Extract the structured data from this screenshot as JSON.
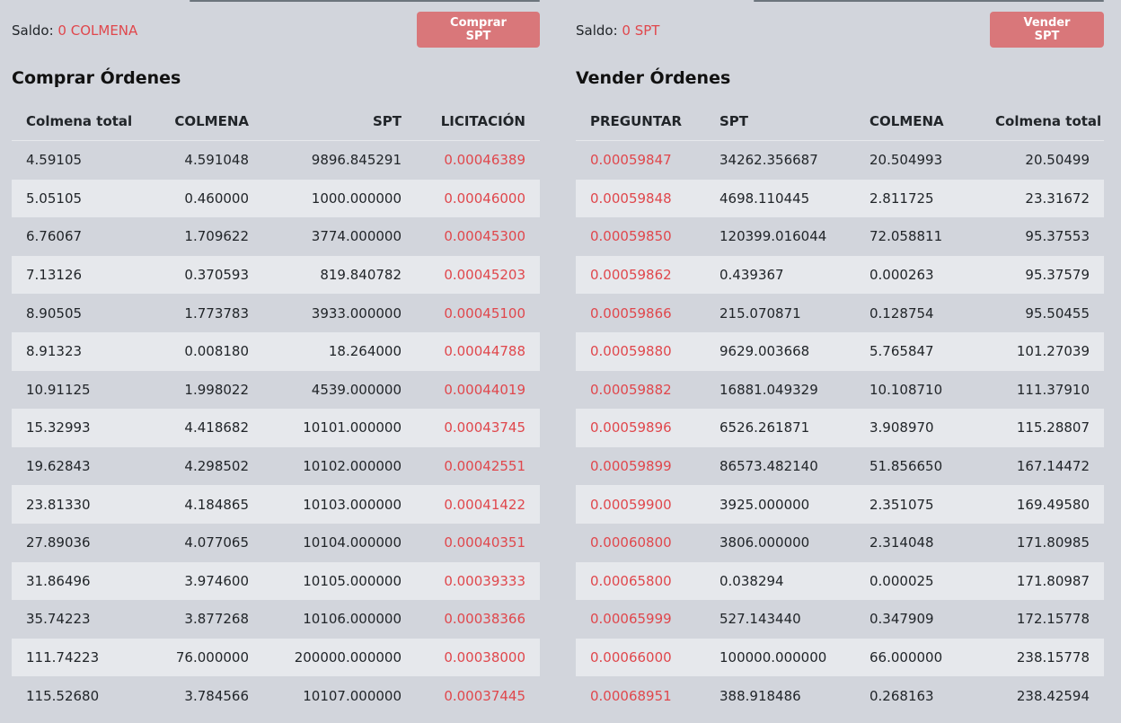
{
  "buy": {
    "saldo_label": "Saldo:",
    "saldo_value": "0 COLMENA",
    "button_label": "Comprar SPT",
    "title": "Comprar Órdenes",
    "headers": [
      "Colmena total",
      "COLMENA",
      "SPT",
      "LICITACIÓN"
    ],
    "rows": [
      [
        "4.59105",
        "4.591048",
        "9896.845291",
        "0.00046389"
      ],
      [
        "5.05105",
        "0.460000",
        "1000.000000",
        "0.00046000"
      ],
      [
        "6.76067",
        "1.709622",
        "3774.000000",
        "0.00045300"
      ],
      [
        "7.13126",
        "0.370593",
        "819.840782",
        "0.00045203"
      ],
      [
        "8.90505",
        "1.773783",
        "3933.000000",
        "0.00045100"
      ],
      [
        "8.91323",
        "0.008180",
        "18.264000",
        "0.00044788"
      ],
      [
        "10.91125",
        "1.998022",
        "4539.000000",
        "0.00044019"
      ],
      [
        "15.32993",
        "4.418682",
        "10101.000000",
        "0.00043745"
      ],
      [
        "19.62843",
        "4.298502",
        "10102.000000",
        "0.00042551"
      ],
      [
        "23.81330",
        "4.184865",
        "10103.000000",
        "0.00041422"
      ],
      [
        "27.89036",
        "4.077065",
        "10104.000000",
        "0.00040351"
      ],
      [
        "31.86496",
        "3.974600",
        "10105.000000",
        "0.00039333"
      ],
      [
        "35.74223",
        "3.877268",
        "10106.000000",
        "0.00038366"
      ],
      [
        "111.74223",
        "76.000000",
        "200000.000000",
        "0.00038000"
      ],
      [
        "115.52680",
        "3.784566",
        "10107.000000",
        "0.00037445"
      ]
    ]
  },
  "sell": {
    "saldo_label": "Saldo:",
    "saldo_value": "0 SPT",
    "button_label": "Vender SPT",
    "title": "Vender Órdenes",
    "headers": [
      "PREGUNTAR",
      "SPT",
      "COLMENA",
      "Colmena total"
    ],
    "rows": [
      [
        "0.00059847",
        "34262.356687",
        "20.504993",
        "20.50499"
      ],
      [
        "0.00059848",
        "4698.110445",
        "2.811725",
        "23.31672"
      ],
      [
        "0.00059850",
        "120399.016044",
        "72.058811",
        "95.37553"
      ],
      [
        "0.00059862",
        "0.439367",
        "0.000263",
        "95.37579"
      ],
      [
        "0.00059866",
        "215.070871",
        "0.128754",
        "95.50455"
      ],
      [
        "0.00059880",
        "9629.003668",
        "5.765847",
        "101.27039"
      ],
      [
        "0.00059882",
        "16881.049329",
        "10.108710",
        "111.37910"
      ],
      [
        "0.00059896",
        "6526.261871",
        "3.908970",
        "115.28807"
      ],
      [
        "0.00059899",
        "86573.482140",
        "51.856650",
        "167.14472"
      ],
      [
        "0.00059900",
        "3925.000000",
        "2.351075",
        "169.49580"
      ],
      [
        "0.00060800",
        "3806.000000",
        "2.314048",
        "171.80985"
      ],
      [
        "0.00065800",
        "0.038294",
        "0.000025",
        "171.80987"
      ],
      [
        "0.00065999",
        "527.143440",
        "0.347909",
        "172.15778"
      ],
      [
        "0.00066000",
        "100000.000000",
        "66.000000",
        "238.15778"
      ],
      [
        "0.00068951",
        "388.918486",
        "0.268163",
        "238.42594"
      ]
    ]
  },
  "colors": {
    "accent_red": "#e0474c",
    "button_bg": "#d9777a",
    "page_bg": "#d2d5dc",
    "stripe": "#e6e8ec"
  }
}
